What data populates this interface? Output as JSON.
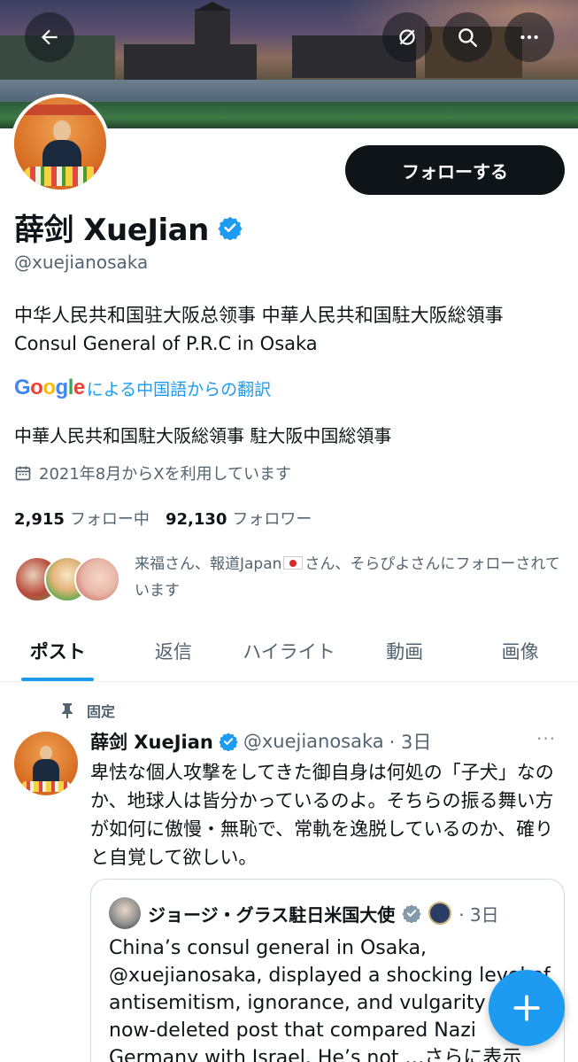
{
  "header": {
    "back_label": "back",
    "icons": [
      "arrow-left-icon",
      "grok-icon",
      "search-icon",
      "more-icon"
    ]
  },
  "profile": {
    "follow_button": "フォローする",
    "display_name": "薛剑 XueJian",
    "handle": "@xuejianosaka",
    "bio_line1": "中华人民共和国驻大阪总领事 中華人民共和国駐大阪総領事",
    "bio_line2": "Consul General of P.R.C in Osaka",
    "translate_brand": "Google",
    "translate_text": "による中国語からの翻訳",
    "bio_translated": "中華人民共和国駐大阪総領事 駐大阪中国総領事",
    "joined": "2021年8月からXを利用しています",
    "following_count": "2,915",
    "following_label": "フォロー中",
    "followers_count": "92,130",
    "followers_label": "フォロワー",
    "followed_by_part1": "来福さん、報道Japan",
    "followed_by_part2": "さん、そらぴよさんにフォローされています"
  },
  "tabs": [
    {
      "label": "ポスト",
      "active": true
    },
    {
      "label": "返信",
      "active": false
    },
    {
      "label": "ハイライト",
      "active": false
    },
    {
      "label": "動画",
      "active": false
    },
    {
      "label": "画像",
      "active": false
    }
  ],
  "pinned_tweet": {
    "pinned_label": "固定",
    "author_name": "薛剑 XueJian",
    "author_handle": "@xuejianosaka",
    "time": "· 3日",
    "more": "···",
    "text": "卑怯な個人攻撃をしてきた御自身は何処の「子犬」なのか、地球人は皆分かっているのよ。そちらの振る舞い方が如何に傲慢・無恥で、常軌を逸脱しているのか、確りと自覚して欲しい。",
    "quote": {
      "author_name": "ジョージ・グラス駐日米国大使",
      "time": "· 3日",
      "text": "China’s consul general in Osaka, @xuejianosaka, displayed a shocking level of antisemitism, ignorance, and vulgarity in a now-deleted post that compared Nazi Germany with Israel. He’s not …さらに表示"
    }
  },
  "colors": {
    "accent": "#1d9bf0",
    "text_primary": "#0f1419",
    "text_secondary": "#536471",
    "follow_bg": "#0f1419"
  }
}
